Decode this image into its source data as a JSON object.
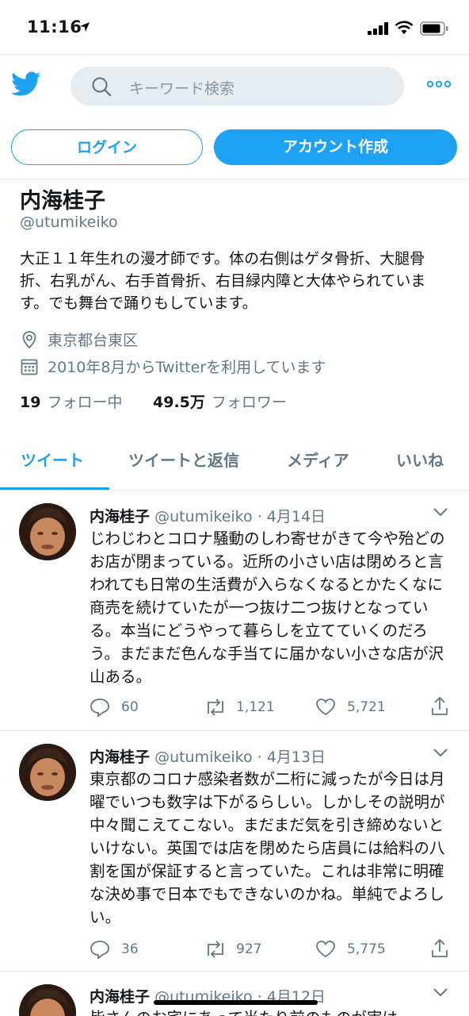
{
  "status_bar": {
    "time": "11:16"
  },
  "search": {
    "placeholder": "キーワード検索"
  },
  "buttons": {
    "login": "ログイン",
    "signup": "アカウント作成"
  },
  "profile": {
    "name": "内海桂子",
    "handle": "@utumikeiko",
    "bio": "大正１１年生れの漫才師です。体の右側はゲタ骨折、大腿骨折、右乳がん、右手首骨折、右目緑内障と大体やられています。でも舞台で踊りもしています。",
    "location": "東京都台東区",
    "joined": "2010年8月からTwitterを利用しています",
    "following_count": "19",
    "following_label": "フォロー中",
    "followers_count": "49.5万",
    "followers_label": "フォロワー"
  },
  "tabs": [
    "ツイート",
    "ツイートと返信",
    "メディア",
    "いいね"
  ],
  "tweets": [
    {
      "name": "内海桂子",
      "handle": "@utumikeiko",
      "date": "· 4月14日",
      "text": "じわじわとコロナ騒動のしわ寄せがきて今や殆どのお店が閉まっている。近所の小さい店は閉めろと言われても日常の生活費が入らなくなるとかたくなに商売を続けていたが一つ抜け二つ抜けとなっている。本当にどうやって暮らしを立てていくのだろう。まだまだ色んな手当てに届かない小さな店が沢山ある。",
      "replies": "60",
      "retweets": "1,121",
      "likes": "5,721"
    },
    {
      "name": "内海桂子",
      "handle": "@utumikeiko",
      "date": "· 4月13日",
      "text": "東京都のコロナ感染者数が二桁に減ったが今日は月曜でいつも数字は下がるらしい。しかしその説明が中々聞こえてこない。まだまだ気を引き締めないといけない。英国では店を閉めたら店員には給料の八割を国が保証すると言っていた。これは非常に明確な決め事で日本でもできないのかね。単純でよろしい。",
      "replies": "36",
      "retweets": "927",
      "likes": "5,775"
    },
    {
      "name": "内海桂子",
      "handle": "@utumikeiko",
      "date": "· 4月12日",
      "text": "皆さんのお宅にあって当たり前のものが実は"
    }
  ],
  "icons": {
    "logo": "twitter-bird-icon",
    "search": "search-icon",
    "more": "more-dots-icon",
    "location": "location-pin-icon",
    "calendar": "calendar-icon",
    "reply": "reply-icon",
    "retweet": "retweet-icon",
    "like": "heart-icon",
    "share": "share-icon"
  },
  "colors": {
    "accent": "#1da1f2",
    "muted": "#657786",
    "text": "#14171a"
  }
}
